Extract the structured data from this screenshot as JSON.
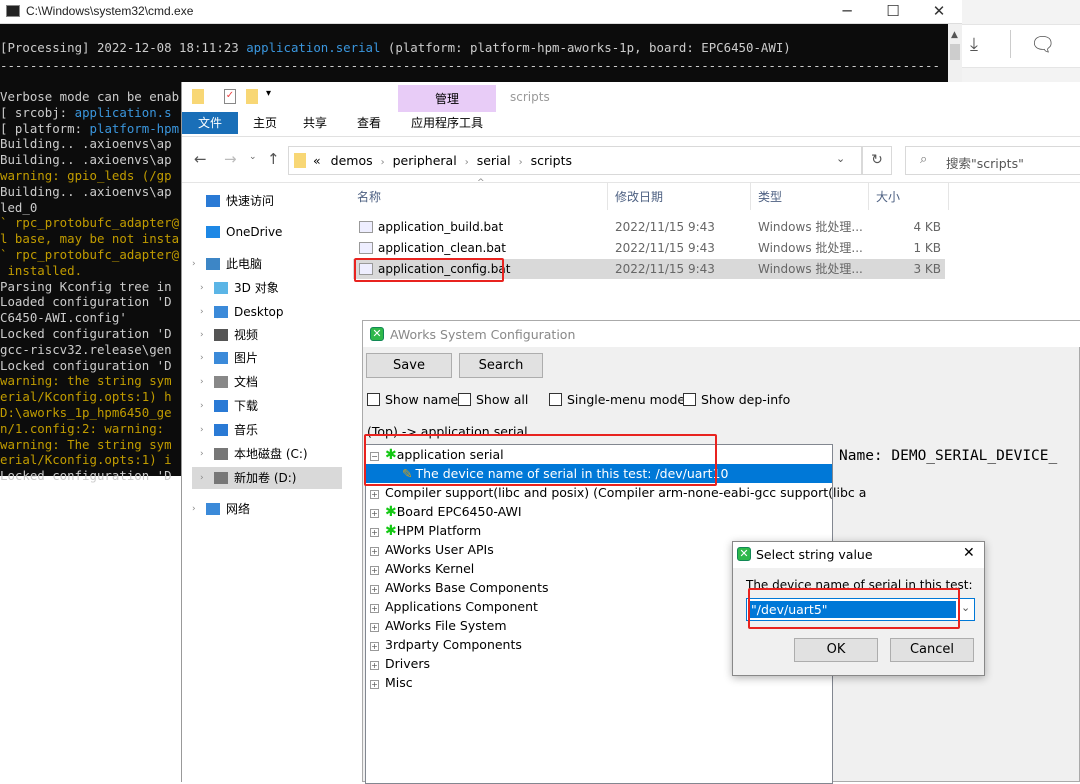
{
  "cmd": {
    "title": "C:\\Windows\\system32\\cmd.exe",
    "header_line": [
      {
        "t": "[Processing] 2022-12-08 18:11:23 ",
        "c": "w"
      },
      {
        "t": "application.serial",
        "c": "c"
      },
      {
        "t": " (platform: platform-hpm-aworks-1p, board: EPC6450-AWI)",
        "c": "w"
      }
    ],
    "separator": "------------------------------------------------------------------------------------------------------------------------------",
    "lines": [
      [
        {
          "t": "Verbose mode can be enab",
          "c": "w"
        }
      ],
      [
        {
          "t": "[ srcobj: ",
          "c": "w"
        },
        {
          "t": "application.s",
          "c": "c"
        }
      ],
      [
        {
          "t": "[ platform: ",
          "c": "w"
        },
        {
          "t": "platform-hpm",
          "c": "c"
        }
      ],
      [
        {
          "t": "Building.. .axioenvs\\ap",
          "c": "w"
        }
      ],
      [
        {
          "t": "Building.. .axioenvs\\ap",
          "c": "w"
        }
      ],
      [
        {
          "t": "warning: gpio_leds (/gp",
          "c": "y"
        }
      ],
      [
        {
          "t": "Building.. .axioenvs\\ap",
          "c": "w"
        }
      ],
      [
        {
          "t": "led_0",
          "c": "w"
        }
      ],
      [
        {
          "t": "` rpc_protobufc_adapter@",
          "c": "y"
        }
      ],
      [
        {
          "t": "l base, may be not insta",
          "c": "y"
        }
      ],
      [
        {
          "t": "` rpc_protobufc_adapter@",
          "c": "y"
        }
      ],
      [
        {
          "t": " installed.",
          "c": "y"
        }
      ],
      [
        {
          "t": "Parsing Kconfig tree in",
          "c": "w"
        }
      ],
      [
        {
          "t": "Loaded configuration 'D",
          "c": "w"
        }
      ],
      [
        {
          "t": "C6450-AWI.config'",
          "c": "w"
        }
      ],
      [
        {
          "t": "Locked configuration 'D",
          "c": "w"
        }
      ],
      [
        {
          "t": "gcc-riscv32.release\\gen",
          "c": "w"
        }
      ],
      [
        {
          "t": "Locked configuration 'D",
          "c": "w"
        }
      ],
      [
        {
          "t": "warning: the string sym",
          "c": "y"
        }
      ],
      [
        {
          "t": "erial/Kconfig.opts:1) h",
          "c": "y"
        }
      ],
      [
        {
          "t": "D:\\aworks_1p_hpm6450_ge",
          "c": "y"
        }
      ],
      [
        {
          "t": "n/1.config:2: warning: ",
          "c": "y"
        }
      ],
      [
        {
          "t": "warning: The string sym",
          "c": "y"
        }
      ],
      [
        {
          "t": "erial/Kconfig.opts:1) i",
          "c": "y"
        }
      ],
      [
        {
          "t": "Locked configuration 'D",
          "c": "w"
        }
      ]
    ]
  },
  "explorer": {
    "context_tab": "管理",
    "window_title": "scripts",
    "tabs": [
      "文件",
      "主页",
      "共享",
      "查看",
      "应用程序工具"
    ],
    "breadcrumb": [
      "«",
      "demos",
      "peripheral",
      "serial",
      "scripts"
    ],
    "search_placeholder": "搜索\"scripts\"",
    "columns": [
      "名称",
      "修改日期",
      "类型",
      "大小"
    ],
    "nav": [
      "快速访问",
      "OneDrive",
      "此电脑",
      "3D 对象",
      "Desktop",
      "视频",
      "图片",
      "文档",
      "下载",
      "音乐",
      "本地磁盘 (C:)",
      "新加卷 (D:)",
      "网络"
    ],
    "files": [
      {
        "name": "application_build.bat",
        "date": "2022/11/15 9:43",
        "type": "Windows 批处理...",
        "size": "4 KB"
      },
      {
        "name": "application_clean.bat",
        "date": "2022/11/15 9:43",
        "type": "Windows 批处理...",
        "size": "1 KB"
      },
      {
        "name": "application_config.bat",
        "date": "2022/11/15 9:43",
        "type": "Windows 批处理...",
        "size": "3 KB"
      }
    ]
  },
  "config": {
    "title": "AWorks System Configuration",
    "save": "Save",
    "search": "Search",
    "checks": [
      "Show name",
      "Show all",
      "Single-menu mode",
      "Show dep-info"
    ],
    "path": "(Top) -> application serial",
    "tree": [
      "application serial",
      "The device name of serial in this test: /dev/uart10",
      "Compiler support(libc and posix) (Compiler arm-none-eabi-gcc support(libc a",
      "Board EPC6450-AWI",
      "HPM Platform",
      "AWorks User APIs",
      "AWorks Kernel",
      "AWorks Base Components",
      "Applications Component",
      "AWorks File System",
      "3rdparty Components",
      "Drivers",
      "Misc"
    ],
    "info": "Name: DEMO_SERIAL_DEVICE_"
  },
  "dialog": {
    "title": "Select string value",
    "label": "The device name of serial in this test:",
    "value": "\"/dev/uart5\"",
    "ok": "OK",
    "cancel": "Cancel"
  },
  "colors": {
    "selection": "#0078d7",
    "highlight_box": "#e8231f",
    "file_tab": "#1a6fb8",
    "context_tab": "#e8ccf7"
  }
}
